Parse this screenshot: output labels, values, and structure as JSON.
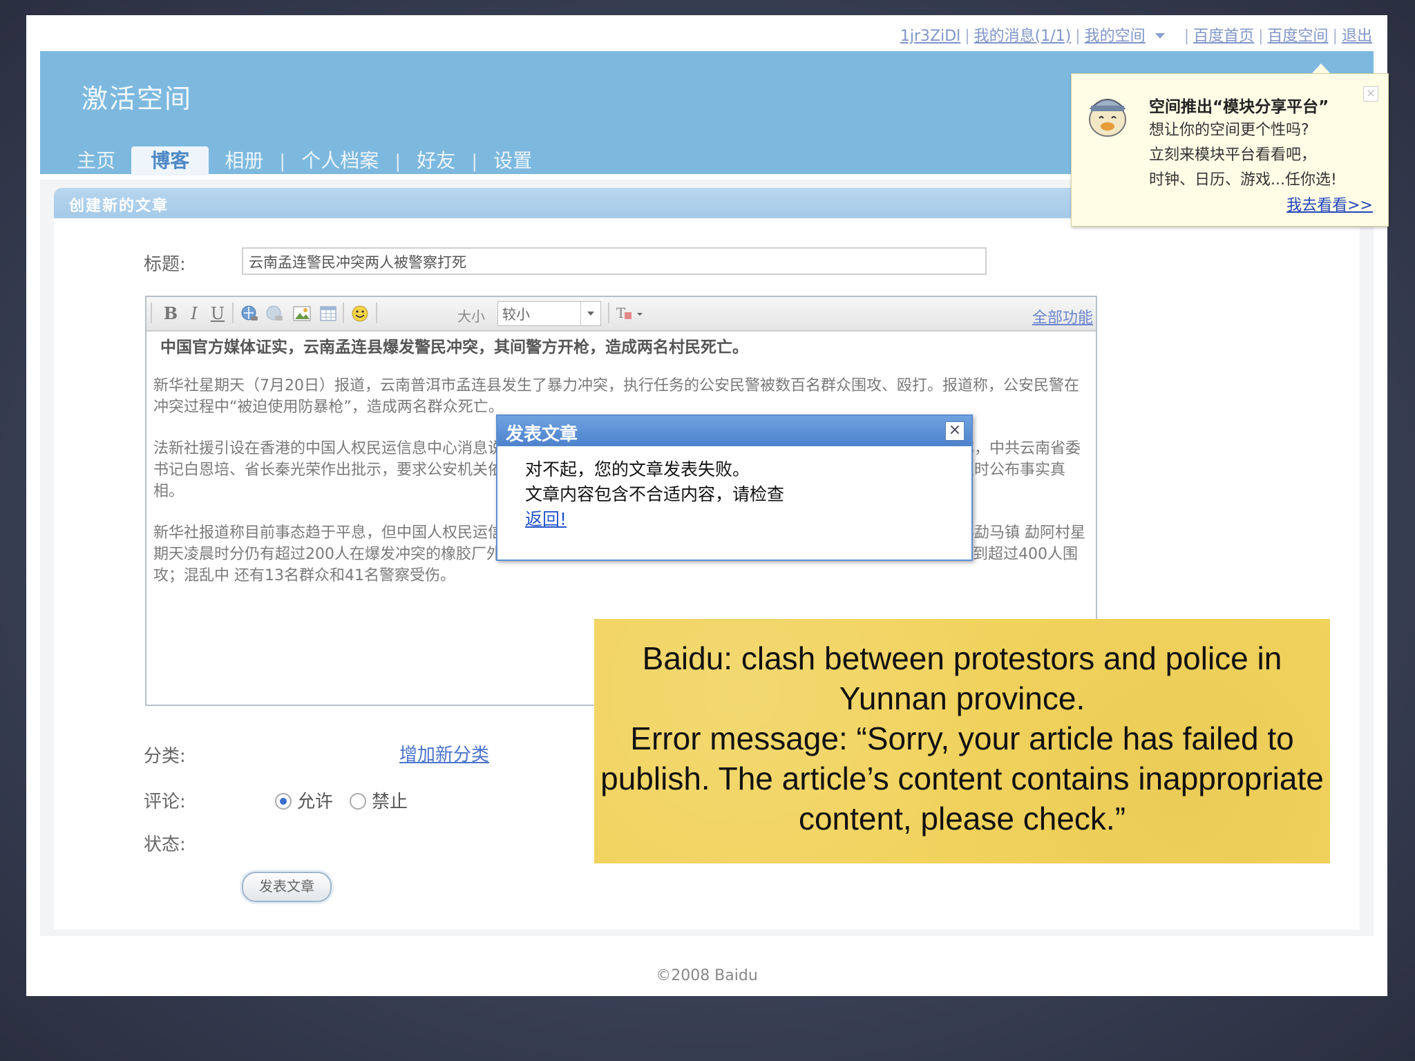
{
  "toplinks": {
    "user": "1jr3ZiDl",
    "messages": "我的消息(1/1)",
    "myspace": "我的空间",
    "baidu_home": "百度首页",
    "baidu_space": "百度空间",
    "logout": "退出"
  },
  "header": {
    "title": "激活空间"
  },
  "nav": {
    "items": [
      {
        "label": "主页"
      },
      {
        "label": "博客"
      },
      {
        "label": "相册"
      },
      {
        "label": "个人档案"
      },
      {
        "label": "好友"
      },
      {
        "label": "设置"
      }
    ],
    "separator": "|",
    "active": "博客"
  },
  "section": {
    "title": "创建新的文章"
  },
  "form": {
    "title_label": "标题:",
    "title_value": "云南孟连警民冲突两人被警察打死",
    "category_label": "分类:",
    "add_category": "增加新分类",
    "comment_label": "评论:",
    "comment_allow": "允许",
    "comment_forbid": "禁止",
    "comment_selected": "允许",
    "status_label": "状态:",
    "publish_button": "发表文章"
  },
  "toolbar": {
    "bold": "B",
    "italic": "I",
    "underline": "U",
    "size_label": "大小",
    "size_value": "较小",
    "all_features": "全部功能",
    "icons": [
      "bold-icon",
      "italic-icon",
      "underline-icon",
      "link-icon",
      "unlink-icon",
      "image-icon",
      "table-icon",
      "smiley-icon",
      "font-color-icon"
    ]
  },
  "editor": {
    "lead": "中国官方媒体证实，云南孟连县爆发警民冲突，其间警方开枪，造成两名村民死亡。",
    "p1": "新华社星期天（7月20日）报道，云南普洱市孟连县发生了暴力冲突，执行任务的公安民警被数百名群众围攻、殴打。报道称，公安民警在冲突过程中“被迫使用防暴枪”，造成两名群众死亡。",
    "p2": "法新社援引设在香港的中国人权民运信息中心消息说，当地胶农长期受到压迫，遭受不公平对待，组织维权活动。新华社称，中共云南省委书记白恩培、省长秦光荣作出批示，要求公安机关依法处置，维护社会稳定，尽快查明事件原委、认真倾听群众诉求，并及时公布事实真相。",
    "p3": "新华社报道称目前事态趋于平息，但中国人权民运信息中心说，当地局势仍然紧张。另据新华社稍早前的英文报道，孟连县勐马镇 勐阿村星期天凌晨时分仍有超过200人在爆发冲突的橡胶厂外聚集。据新华社英文电讯称，星期六爆发警民冲突时，现场公安民警遭到超过400人围攻；混乱中 还有13名群众和41名警察受伤。"
  },
  "modal": {
    "title": "发表文章",
    "close": "×",
    "line1": "对不起，您的文章发表失败。",
    "line2": "文章内容包含不合适内容，请检查",
    "link": "返回!"
  },
  "promo": {
    "title": "空间推出“模块分享平台”",
    "line1": "想让你的空间更个性吗?",
    "line2": "立刻来模块平台看看吧，",
    "line3": "时钟、日历、游戏...任你选!",
    "link": "我去看看>>",
    "close": "×"
  },
  "footer": {
    "copyright": "©2008 Baidu"
  },
  "caption": {
    "text": "Baidu: clash between protestors and police in Yunnan province.\nError message: “Sorry, your article has failed to publish. The article’s content contains inappropriate content, please check.”"
  },
  "colors": {
    "header_blue": "#7db9df",
    "modal_blue": "#4d82cc",
    "caption_yellow": "#f1d35e",
    "link_blue": "#4a73cc"
  }
}
